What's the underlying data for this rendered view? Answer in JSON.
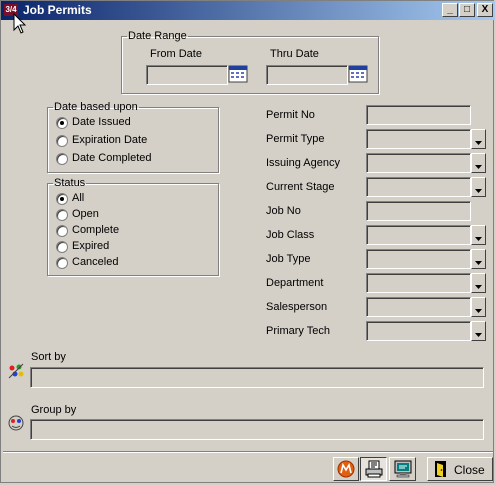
{
  "window": {
    "title": "Job Permits",
    "controls": [
      "_",
      "□",
      "X"
    ]
  },
  "date_range": {
    "legend": "Date Range",
    "from_label": "From Date",
    "thru_label": "Thru Date",
    "from_value": "",
    "thru_value": ""
  },
  "date_based_upon": {
    "legend": "Date based upon",
    "options": [
      "Date Issued",
      "Expiration Date",
      "Date Completed"
    ],
    "selected": "Date Issued"
  },
  "status": {
    "legend": "Status",
    "options": [
      "All",
      "Open",
      "Complete",
      "Expired",
      "Canceled"
    ],
    "selected": "All"
  },
  "filters": {
    "permit_no": {
      "label": "Permit No",
      "value": ""
    },
    "permit_type": {
      "label": "Permit Type",
      "value": ""
    },
    "issuing_agency": {
      "label": "Issuing Agency",
      "value": ""
    },
    "current_stage": {
      "label": "Current Stage",
      "value": ""
    },
    "job_no": {
      "label": "Job No",
      "value": ""
    },
    "job_class": {
      "label": "Job Class",
      "value": ""
    },
    "job_type": {
      "label": "Job Type",
      "value": ""
    },
    "department": {
      "label": "Department",
      "value": ""
    },
    "salesperson": {
      "label": "Salesperson",
      "value": ""
    },
    "primary_tech": {
      "label": "Primary Tech",
      "value": ""
    }
  },
  "sort_by": {
    "label": "Sort by",
    "value": "",
    "icon": "sort-icon"
  },
  "group_by": {
    "label": "Group by",
    "value": "",
    "icon": "group-icon"
  },
  "buttons": {
    "close_label": "Close"
  },
  "colors": {
    "face": "#d4d0c8",
    "title_start": "#0a246a",
    "title_end": "#a6caf0",
    "accent": "#e06010"
  }
}
